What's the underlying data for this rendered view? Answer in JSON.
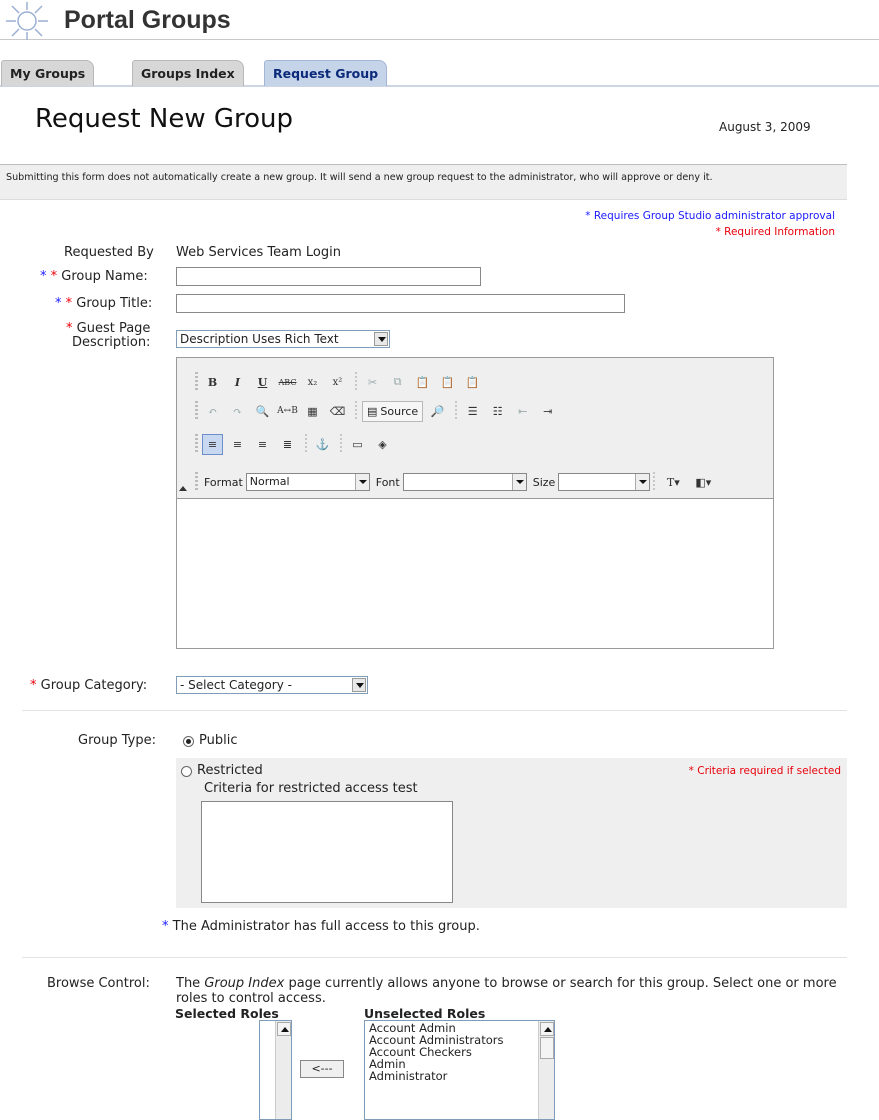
{
  "header": {
    "title": "Portal Groups"
  },
  "tabs": [
    {
      "label": "My Groups"
    },
    {
      "label": "Groups Index"
    },
    {
      "label": "Request Group"
    }
  ],
  "page": {
    "title": "Request New Group",
    "date": "August 3, 2009",
    "notice": "Submitting this form does not automatically create a new group. It will send a new group request to the administrator, who will approve or deny it.",
    "legend_admin": "* Requires Group Studio administrator approval",
    "legend_required": "* Required Information"
  },
  "form": {
    "requested_by_label": "Requested By",
    "requested_by_value": "Web Services Team Login",
    "group_name_label": "Group Name:",
    "group_name_value": "",
    "group_title_label": "Group Title:",
    "group_title_value": "",
    "guest_page_label_1": "Guest Page",
    "guest_page_label_2": "Description:",
    "description_mode": "Description Uses Rich Text",
    "group_category_label": "Group Category:",
    "group_category_value": "- Select Category -",
    "group_type_label": "Group Type:",
    "public_label": "Public",
    "restricted_label": "Restricted",
    "criteria_note": "* Criteria required if selected",
    "criteria_label": "Criteria for restricted access test",
    "admin_note": "The Administrator has full access to this group.",
    "browse_control_label": "Browse Control:",
    "browse_text_1": "The ",
    "browse_text_em": "Group Index",
    "browse_text_2": " page currently allows anyone to browse or search for this group. Select one or more roles to control access.",
    "selected_roles_label": "Selected Roles",
    "unselected_roles_label": "Unselected Roles",
    "move_left_button": "<---",
    "unselected_roles": [
      "Account Admin",
      "Account Administrators",
      "Account Checkers",
      "Admin",
      "Administrator"
    ]
  },
  "editor": {
    "source_label": "Source",
    "format_label": "Format",
    "format_value": "Normal",
    "font_label": "Font",
    "font_value": "",
    "size_label": "Size",
    "size_value": ""
  },
  "colors": {
    "required_blue": "#1a1aff",
    "required_red": "#e8000b",
    "active_tab": "#c6d4ea"
  }
}
